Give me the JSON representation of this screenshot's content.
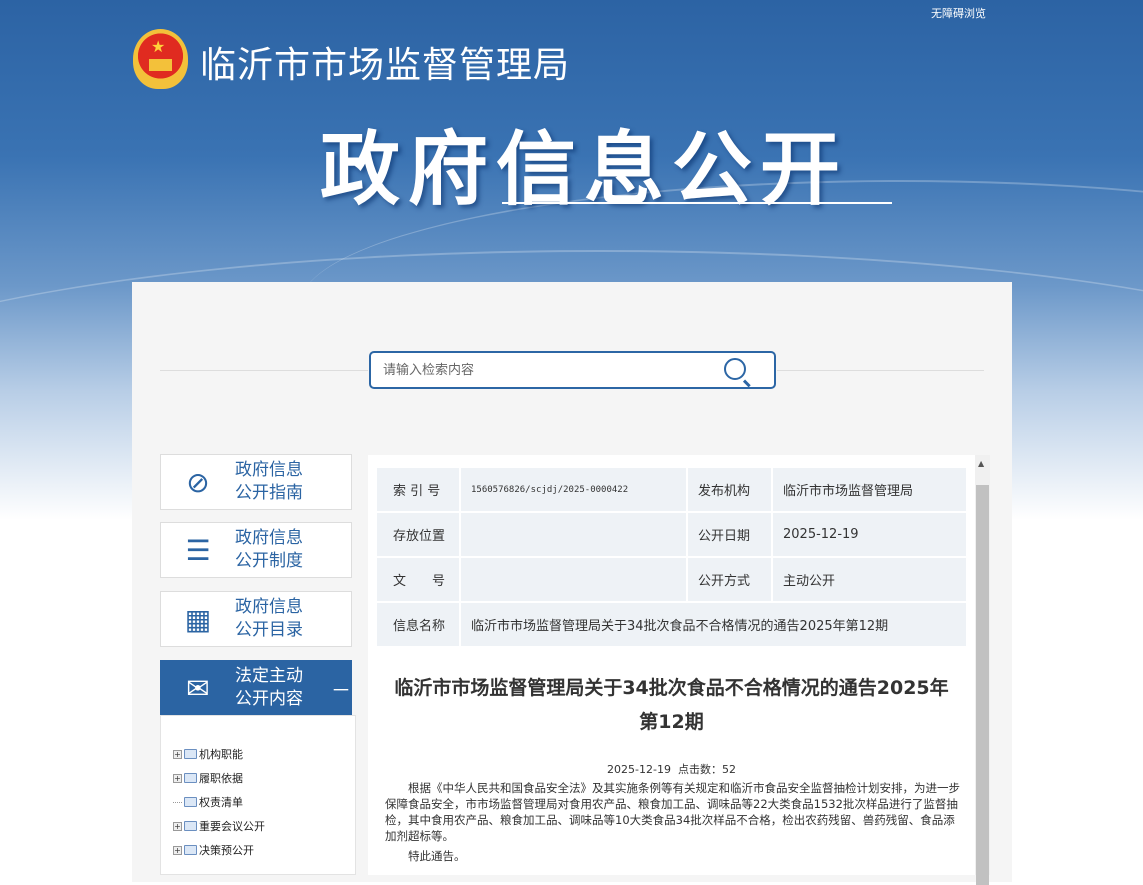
{
  "header": {
    "accessibility_link": "无障碍浏览",
    "org_name": "临沂市市场监督管理局",
    "banner_title": "政府信息公开"
  },
  "search": {
    "placeholder": "请输入检索内容"
  },
  "sidebar": {
    "items": [
      {
        "line1": "政府信息",
        "line2": "公开指南",
        "icon": "compass-icon"
      },
      {
        "line1": "政府信息",
        "line2": "公开制度",
        "icon": "list-icon"
      },
      {
        "line1": "政府信息",
        "line2": "公开目录",
        "icon": "grid-icon"
      },
      {
        "line1": "法定主动",
        "line2": "公开内容",
        "icon": "envelope-icon",
        "toggle": "－"
      }
    ],
    "tree": [
      "机构职能",
      "履职依据",
      "权责清单",
      "重要会议公开",
      "决策预公开"
    ]
  },
  "meta_table": {
    "index_label": "索 引 号",
    "index_value": "1560576826/scjdj/2025-0000422",
    "publisher_label": "发布机构",
    "publisher_value": "临沂市市场监督管理局",
    "location_label": "存放位置",
    "location_value": "",
    "date_label": "公开日期",
    "date_value": "2025-12-19",
    "docno_label": "文　　号",
    "docno_value": "",
    "method_label": "公开方式",
    "method_value": "主动公开",
    "name_label": "信息名称",
    "name_value": "临沂市市场监督管理局关于34批次食品不合格情况的通告2025年第12期"
  },
  "article": {
    "title_line1": "临沂市市场监督管理局关于34批次食品不合格情况的通告2025年",
    "title_line2": "第12期",
    "meta": "2025-12-19  点击数：52",
    "paragraph1": "根据《中华人民共和国食品安全法》及其实施条例等有关规定和临沂市食品安全监督抽检计划安排，为进一步保障食品安全，市市场监督管理局对食用农产品、粮食加工品、调味品等22大类食品1532批次样品进行了监督抽检，其中食用农产品、粮食加工品、调味品等10大类食品34批次样品不合格，检出农药残留、兽药残留、食品添加剂超标等。",
    "paragraph2": "特此通告。"
  }
}
